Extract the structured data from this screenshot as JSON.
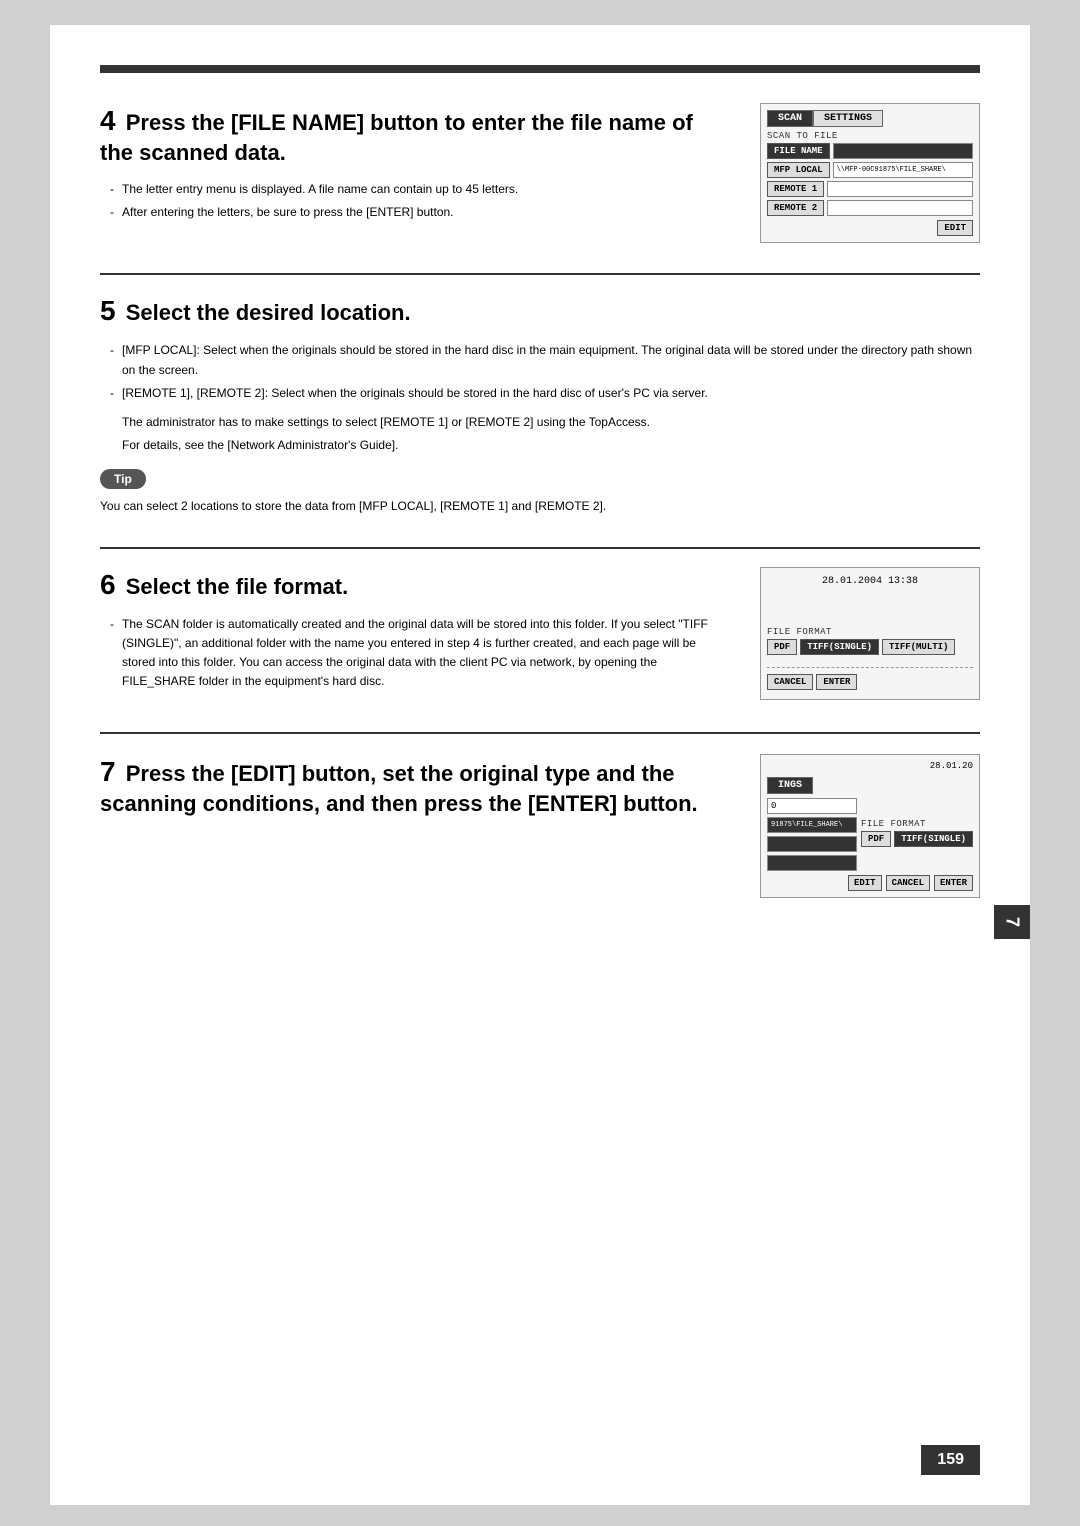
{
  "page": {
    "page_number": "159",
    "side_tab": "7"
  },
  "step4": {
    "number": "4",
    "heading": "Press the [FILE NAME] button to enter the file name of the scanned data.",
    "bullets": [
      "The letter entry menu is displayed. A file name can contain up to 45 letters.",
      "After entering the letters, be sure to press the [ENTER] button."
    ]
  },
  "step5": {
    "number": "5",
    "heading": "Select the desired location.",
    "bullets": [
      "[MFP LOCAL]: Select when the originals should be stored in the hard disc in the main equipment. The original data will be stored under the directory path shown on the screen.",
      "[REMOTE 1], [REMOTE 2]: Select when the originals should be stored in the hard disc of user's PC via server."
    ],
    "extra_text1": "The administrator has to make settings to select [REMOTE 1] or [REMOTE 2] using the TopAccess.",
    "extra_text2": "For details, see the [Network Administrator's Guide]."
  },
  "tip": {
    "label": "Tip",
    "text": "You can select 2 locations to store the data from [MFP LOCAL], [REMOTE 1] and [REMOTE 2]."
  },
  "step6": {
    "number": "6",
    "heading": "Select the file format.",
    "bullets": [
      "The SCAN folder is automatically created and the original data will be stored into this folder. If you select \"TIFF (SINGLE)\", an additional folder with the name you entered in step 4 is further created, and each page will be stored into this folder. You can access the original data with the client PC via network, by opening the FILE_SHARE folder in the equipment's hard disc."
    ]
  },
  "step7": {
    "number": "7",
    "heading": "Press the [EDIT] button, set the original type and the scanning conditions, and then press the [ENTER] button."
  },
  "panel1": {
    "tab_scan": "SCAN",
    "tab_settings": "SETTINGS",
    "scan_to_file": "SCAN TO FILE",
    "file_name_label": "FILE NAME",
    "file_name_value": "",
    "mfp_local_label": "MFP LOCAL",
    "mfp_local_value": "\\\\MFP-00C91875\\FILE_SHARE\\",
    "remote1_label": "REMOTE 1",
    "remote1_value": "",
    "remote2_label": "REMOTE 2",
    "remote2_value": "",
    "edit_btn": "EDIT"
  },
  "panel2": {
    "timestamp": "28.01.2004  13:38",
    "file_format_label": "FILE FORMAT",
    "btn_pdf": "PDF",
    "btn_tiff_single": "TIFF(SINGLE)",
    "btn_tiff_multi": "TIFF(MULTI)",
    "btn_cancel": "CANCEL",
    "btn_enter": "ENTER"
  },
  "panel3": {
    "timestamp": "28.01.20",
    "tab_ings": "INGS",
    "field1_label": "0",
    "file_format_label": "FILE FORMAT",
    "field_path": "91875\\FILE_SHARE\\",
    "btn_pdf": "PDF",
    "btn_tiff_single": "TIFF(SINGLE)",
    "btn_edit": "EDIT",
    "btn_cancel": "CANCEL",
    "btn_enter": "ENTER"
  }
}
